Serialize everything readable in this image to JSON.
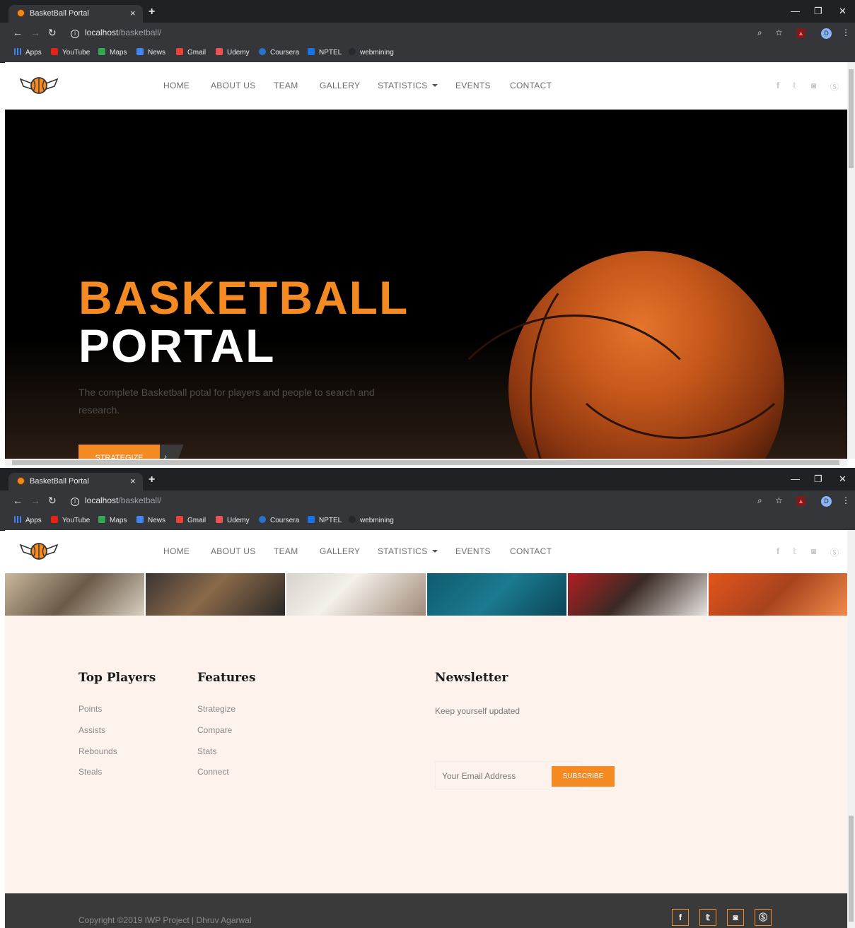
{
  "browser": {
    "tab_title": "BasketBall Portal",
    "tab_close": "×",
    "new_tab": "+",
    "url_host": "localhost",
    "url_path": "/basketball/",
    "bookmarks": [
      "Apps",
      "YouTube",
      "Maps",
      "News",
      "Gmail",
      "Udemy",
      "Coursera",
      "NPTEL",
      "webmining"
    ],
    "profile_initial": "D"
  },
  "nav": {
    "items": [
      "HOME",
      "ABOUT US",
      "TEAM",
      "GALLERY",
      "STATISTICS",
      "EVENTS",
      "CONTACT"
    ]
  },
  "social_icons": [
    "facebook-icon",
    "twitter-icon",
    "instagram-icon",
    "skype-icon"
  ],
  "hero": {
    "title_line1": "BASKETBALL",
    "title_line2": "PORTAL",
    "subtitle": "The complete Basketball potal for players and people to search and research.",
    "cta_label": "STRATEGIZE",
    "cta_arrow": "›"
  },
  "colors": {
    "accent": "#f58a22",
    "footer_bg": "#3a3a3a",
    "cream_bg": "#fdf3ec"
  },
  "footer_cols": {
    "top_players": {
      "title": "Top Players",
      "links": [
        "Points",
        "Assists",
        "Rebounds",
        "Steals"
      ]
    },
    "features": {
      "title": "Features",
      "links": [
        "Strategize",
        "Compare",
        "Stats",
        "Connect"
      ]
    },
    "newsletter": {
      "title": "Newsletter",
      "text": "Keep yourself updated",
      "email_placeholder": "Your Email Address",
      "subscribe_label": "SUBSCRIBE"
    }
  },
  "footer": {
    "copyright": "Copyright ©2019 IWP Project | Dhruv Agarwal"
  }
}
